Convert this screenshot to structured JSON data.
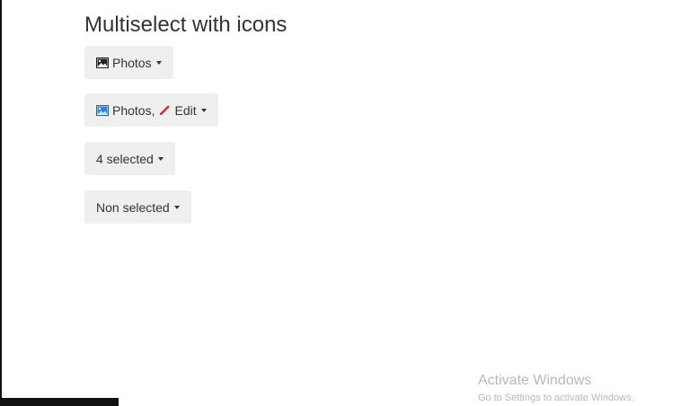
{
  "page": {
    "title": "Multiselect with icons"
  },
  "multiselects": [
    {
      "icons": [
        "picture-icon"
      ],
      "text": "Photos"
    },
    {
      "icons": [
        "picture-color-icon",
        "pencil-icon"
      ],
      "segments": [
        "Photos,",
        "Edit"
      ]
    },
    {
      "text": "4 selected"
    },
    {
      "text": "Non selected"
    }
  ],
  "colors": {
    "button_bg": "#efefef",
    "pencil": "#d9302a",
    "picture_blue": "#2f7fd3"
  },
  "watermark": {
    "title": "Activate Windows",
    "subtitle": "Go to Settings to activate Windows."
  }
}
